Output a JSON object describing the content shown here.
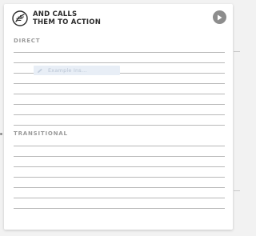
{
  "card": {
    "title_line1": "AND CALLS",
    "title_line2": "THEM TO ACTION"
  },
  "icons": {
    "logo": "feather-circle-icon",
    "play": "play-icon",
    "chip": "pencil-icon"
  },
  "sections": [
    {
      "label": "DIRECT",
      "line_count": 8
    },
    {
      "label": "TRANSITIONAL",
      "line_count": 7
    }
  ],
  "example_chip": {
    "text": "Example Ins..."
  },
  "colors": {
    "play_button": "#8d8d8d",
    "section_label": "#9a9a9a",
    "rule_line": "#b8b8b8",
    "chip_bg": "#e8eef6"
  }
}
